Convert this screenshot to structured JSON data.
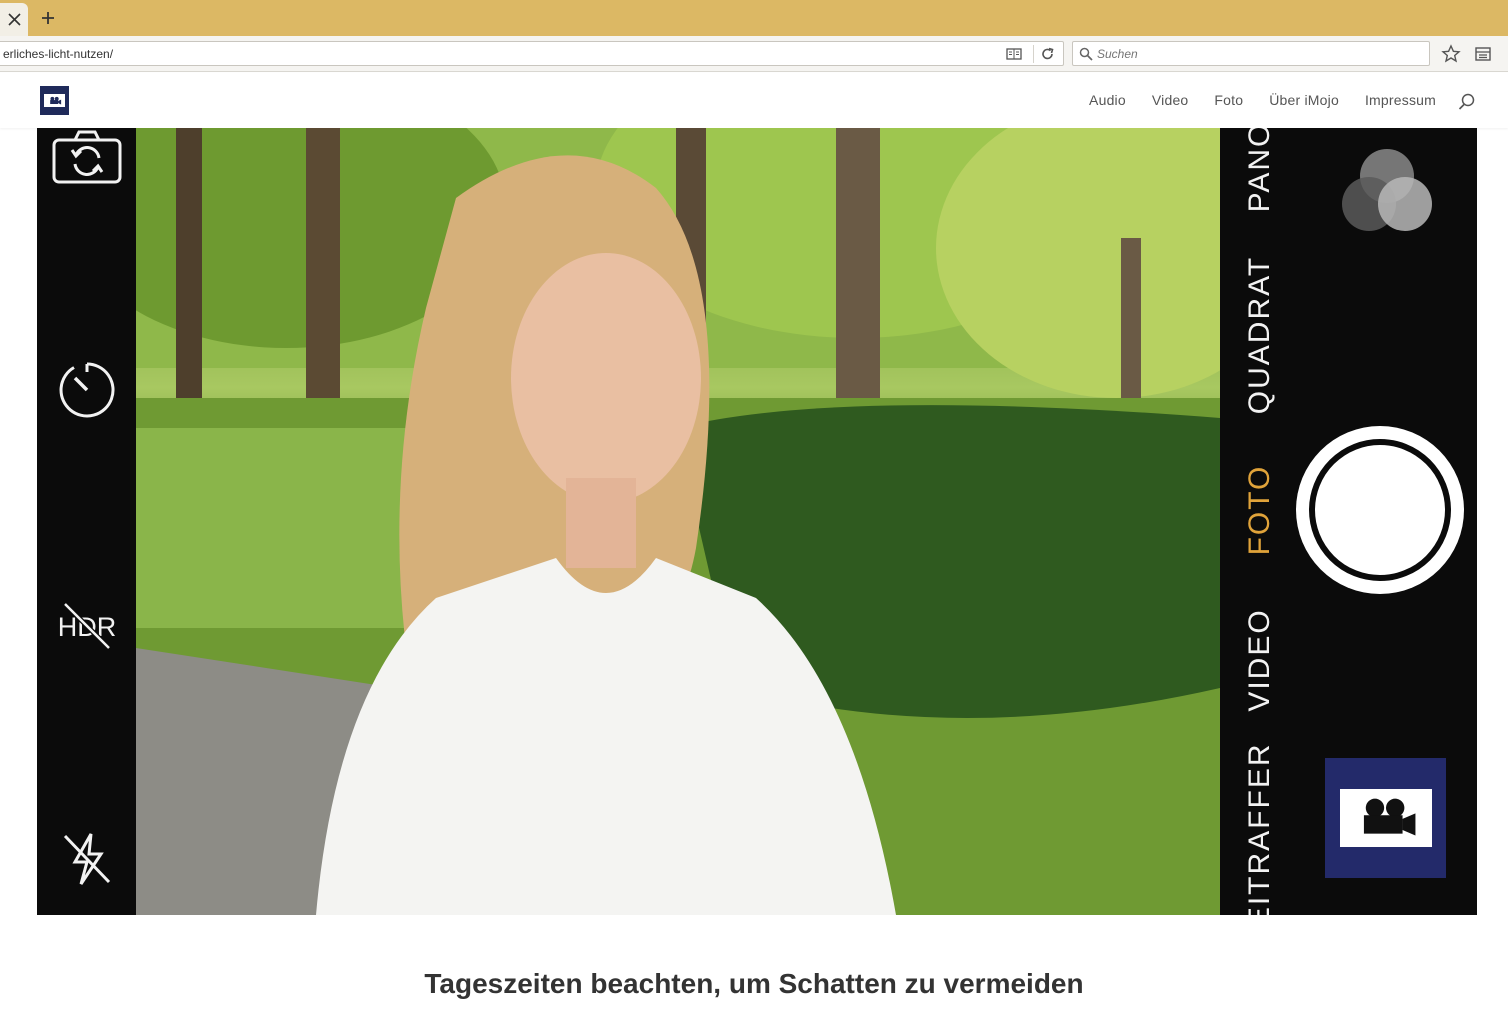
{
  "browser": {
    "url_text": "erliches-licht-nutzen/",
    "search_placeholder": "Suchen",
    "tabstrip_color": "#dcb864"
  },
  "site": {
    "brand_color": "#1f2a5a",
    "nav": {
      "audio": "Audio",
      "video": "Video",
      "foto": "Foto",
      "ueber": "Über iMojo",
      "impressum": "Impressum"
    }
  },
  "camera_ui": {
    "modes": {
      "pano": "PANO",
      "quadrat": "QUADRAT",
      "foto": "FOTO",
      "video": "VIDEO",
      "zeitraffer": "ZEITRAFFER"
    },
    "active_mode": "FOTO",
    "active_color": "#e0a33a",
    "hdr_label": "HDR",
    "icons": [
      "camera-switch-icon",
      "timer-icon",
      "hdr-off-icon",
      "flash-off-icon",
      "filters-icon",
      "video-camera-icon"
    ]
  },
  "caption": "Tageszeiten beachten, um Schatten zu vermeiden"
}
